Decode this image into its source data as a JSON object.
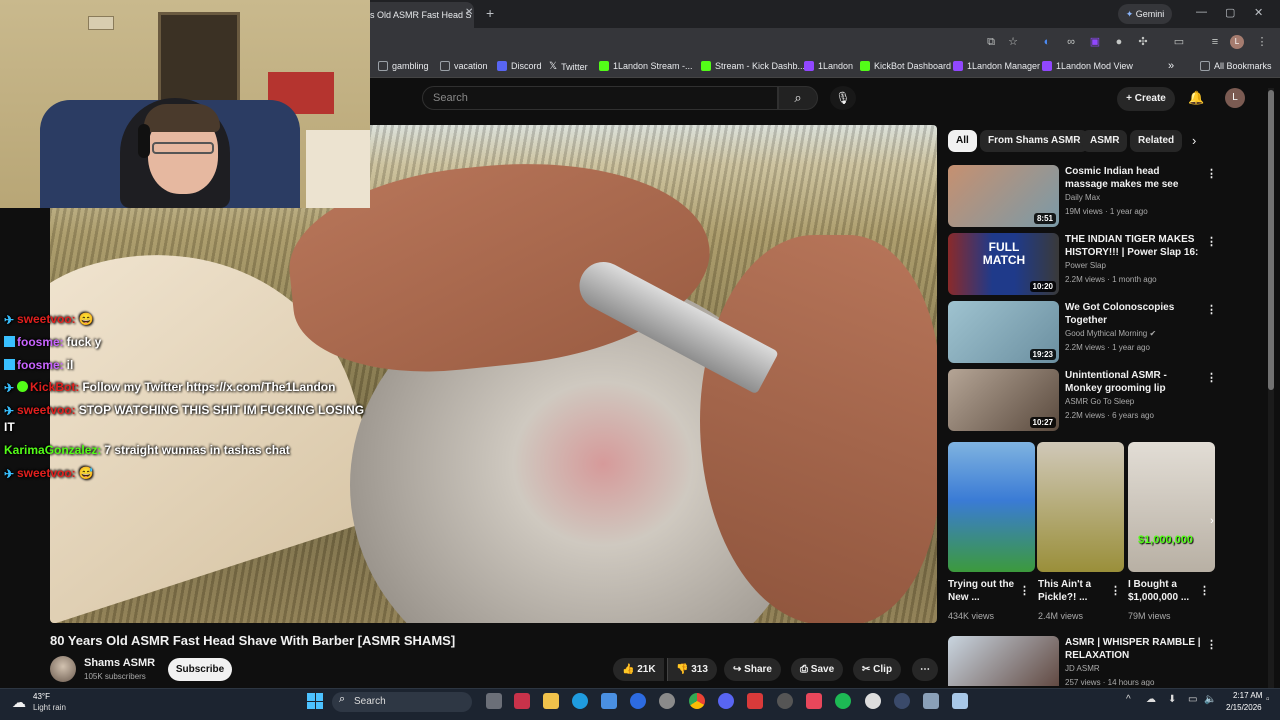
{
  "browser": {
    "tab_title": "s Old ASMR Fast Head S",
    "gemini_label": "Gemini",
    "bookmarks": [
      {
        "label": "gambling",
        "color": "#9aa0a6"
      },
      {
        "label": "vacation",
        "color": "#9aa0a6"
      },
      {
        "label": "Discord",
        "color": "#5865f2"
      },
      {
        "label": "Twitter",
        "color": "#000000"
      },
      {
        "label": "1Landon Stream -...",
        "color": "#53fc18"
      },
      {
        "label": "Stream - Kick Dashb...",
        "color": "#53fc18"
      },
      {
        "label": "1Landon",
        "color": "#9147ff"
      },
      {
        "label": "KickBot Dashboard",
        "color": "#53fc18"
      },
      {
        "label": "1Landon Manager",
        "color": "#9147ff"
      },
      {
        "label": "1Landon Mod View",
        "color": "#9147ff"
      }
    ],
    "all_bookmarks": "All Bookmarks",
    "profile_initial": "L"
  },
  "youtube": {
    "search_placeholder": "Search",
    "create_label": "Create",
    "user_initial": "L",
    "video_title": "80 Years Old ASMR Fast Head Shave With Barber [ASMR SHAMS]",
    "channel_name": "Shams ASMR",
    "channel_subs": "105K subscribers",
    "subscribe_label": "Subscribe",
    "likes": "21K",
    "dislikes": "313",
    "share_label": "Share",
    "save_label": "Save",
    "clip_label": "Clip",
    "chips": [
      "All",
      "From Shams ASMR",
      "ASMR",
      "Related"
    ],
    "recommendations": [
      {
        "title": "Cosmic Indian head massage makes me see stars 💫😮",
        "channel": "Daily Max",
        "meta": "19M views · 1 year ago",
        "duration": "8:51",
        "thumb": "#b8866a"
      },
      {
        "title": "THE INDIAN TIGER MAKES HISTORY!!! | Power Slap 16: ...",
        "channel": "Power Slap",
        "meta": "2.2M views · 1 month ago",
        "duration": "10:20",
        "thumb": "#1f3a8a",
        "overlay": "FULL MATCH"
      },
      {
        "title": "We Got Colonoscopies Together",
        "channel": "Good Mythical Morning",
        "meta": "2.2M views · 1 year ago",
        "duration": "19:23",
        "thumb": "#7fa6b6"
      },
      {
        "title": "Unintentional ASMR - Monkey grooming lip smacking 🐒 - n...",
        "channel": "ASMR Go To Sleep",
        "meta": "2.2M views · 6 years ago",
        "duration": "10:27",
        "thumb": "#8c7a6a"
      }
    ],
    "shorts": [
      {
        "title": "Trying out the New ...",
        "views": "434K views",
        "thumb": "#3a7bd5"
      },
      {
        "title": "This Ain't a Pickle?! ...",
        "views": "2.4M views",
        "thumb": "#9a8f3a"
      },
      {
        "title": "I Bought a $1,000,000 ...",
        "views": "79M views",
        "thumb": "#c9c2b6",
        "overlay": "$1,000,000"
      }
    ],
    "last_rec": {
      "title": "ASMR | WHISPER RAMBLE | RELAXATION",
      "channel": "JD ASMR",
      "meta": "257 views · 14 hours ago",
      "thumb": "#5a3f36"
    }
  },
  "chat": [
    {
      "user": "sweetvoo:",
      "msg": "😄",
      "color": "#e0201e",
      "badge": "#39c0ff"
    },
    {
      "user": "foosme:",
      "msg": "fuck y",
      "color": "#c864ff",
      "badge": "#39c0ff"
    },
    {
      "user": "foosme:",
      "msg": "il",
      "color": "#c864ff",
      "badge": "#39c0ff"
    },
    {
      "user": "KickBot:",
      "msg": "Follow my Twitter https://x.com/The1Landon",
      "color": "#e0201e",
      "badge": "#53fc18"
    },
    {
      "user": "sweetvoo:",
      "msg": "STOP WATCHING THIS SHIT IM FUCKING LOSING",
      "color": "#e0201e",
      "badge": "#39c0ff"
    },
    {
      "user": "",
      "msg": "IT",
      "color": "#ffffff",
      "badge": ""
    },
    {
      "user": "KarimaGonzalez:",
      "msg": "7 straight wunnas in tashas chat",
      "color": "#53fc18",
      "badge": ""
    },
    {
      "user": "sweetvoo:",
      "msg": "😅",
      "color": "#e0201e",
      "badge": "#39c0ff"
    }
  ],
  "taskbar": {
    "temp": "43°F",
    "weather": "Light rain",
    "search_label": "Search",
    "time": "2:17 AM",
    "date": "2/15/2026"
  }
}
